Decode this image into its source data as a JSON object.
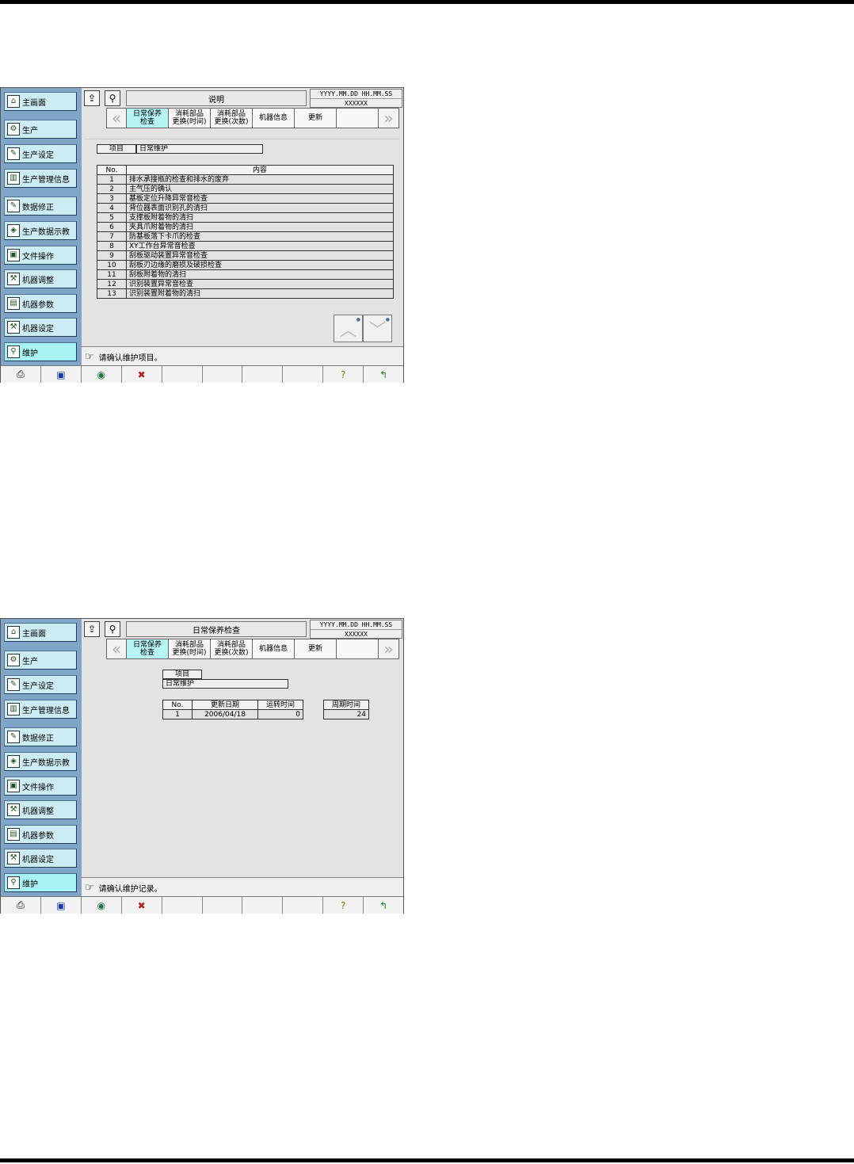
{
  "colors": {
    "sidebar_bg": "#7fa6c9",
    "side_button": "#ccecf3",
    "active": "#a9f2f4",
    "panel": "#e3e3e3"
  },
  "sidebar": {
    "items": [
      {
        "label": "主画面",
        "icon": "home-icon"
      },
      {
        "label": "生产",
        "icon": "production-icon"
      },
      {
        "label": "生产设定",
        "icon": "production-setting-icon"
      },
      {
        "label": "生产管理信息",
        "icon": "management-info-icon"
      },
      {
        "label": "数据修正",
        "icon": "data-edit-icon"
      },
      {
        "label": "生产数据示教",
        "icon": "teaching-icon"
      },
      {
        "label": "文件操作",
        "icon": "floppy-icon"
      },
      {
        "label": "机器调整",
        "icon": "adjust-icon"
      },
      {
        "label": "机器参数",
        "icon": "parameter-icon"
      },
      {
        "label": "机器设定",
        "icon": "machine-setting-icon"
      },
      {
        "label": "维护",
        "icon": "maintenance-icon"
      }
    ]
  },
  "header": {
    "datetime": "YYYY.MM.DD HH.MM.SS",
    "user": "XXXXXX"
  },
  "tabs": [
    {
      "label1": "日常保养",
      "label2": "检查"
    },
    {
      "label1": "消耗部品",
      "label2": "更换(时间)"
    },
    {
      "label1": "消耗部品",
      "label2": "更换(次数)"
    },
    {
      "label1": "机器信息",
      "label2": ""
    },
    {
      "label1": "更新",
      "label2": ""
    },
    {
      "label1": "",
      "label2": ""
    }
  ],
  "bottom_bar": [
    "printer-icon",
    "screen-icon",
    "globe-icon",
    "sound-off-icon",
    "",
    "",
    "",
    "",
    "help-icon",
    "return-icon"
  ],
  "screen1": {
    "title": "说明",
    "item_label": "项目",
    "item_value": "日常维护",
    "headers": {
      "no": "No.",
      "content": "内容"
    },
    "rows": [
      {
        "no": "1",
        "content": "排水承接瓶的检查和排水的废弃"
      },
      {
        "no": "2",
        "content": "主气压的确认"
      },
      {
        "no": "3",
        "content": "基板定位升降异常音检查"
      },
      {
        "no": "4",
        "content": "背位器表面识别孔的清扫"
      },
      {
        "no": "5",
        "content": "支撑板附着物的清扫"
      },
      {
        "no": "6",
        "content": "夹具爪附着物的清扫"
      },
      {
        "no": "7",
        "content": "防基板落下卡爪的检查"
      },
      {
        "no": "8",
        "content": "XY工作台异常音检查"
      },
      {
        "no": "9",
        "content": "刮板驱动装置异常音检查"
      },
      {
        "no": "10",
        "content": "刮板刃边缘的磨损及破损检查"
      },
      {
        "no": "11",
        "content": "刮板附着物的清扫"
      },
      {
        "no": "12",
        "content": "识别装置异常音检查"
      },
      {
        "no": "13",
        "content": "识别装置附着物的清扫"
      }
    ],
    "status": "请确认维护项目。"
  },
  "screen2": {
    "title": "日常保养检查",
    "item_label": "项目",
    "item_value": "日常维护",
    "headers": {
      "no": "No.",
      "date": "更新日期",
      "runtime": "运转时间",
      "period": "周期时间"
    },
    "row": {
      "no": "1",
      "date": "2006/04/18",
      "runtime": "0",
      "period": "24"
    },
    "status": "请确认维护记录。"
  }
}
